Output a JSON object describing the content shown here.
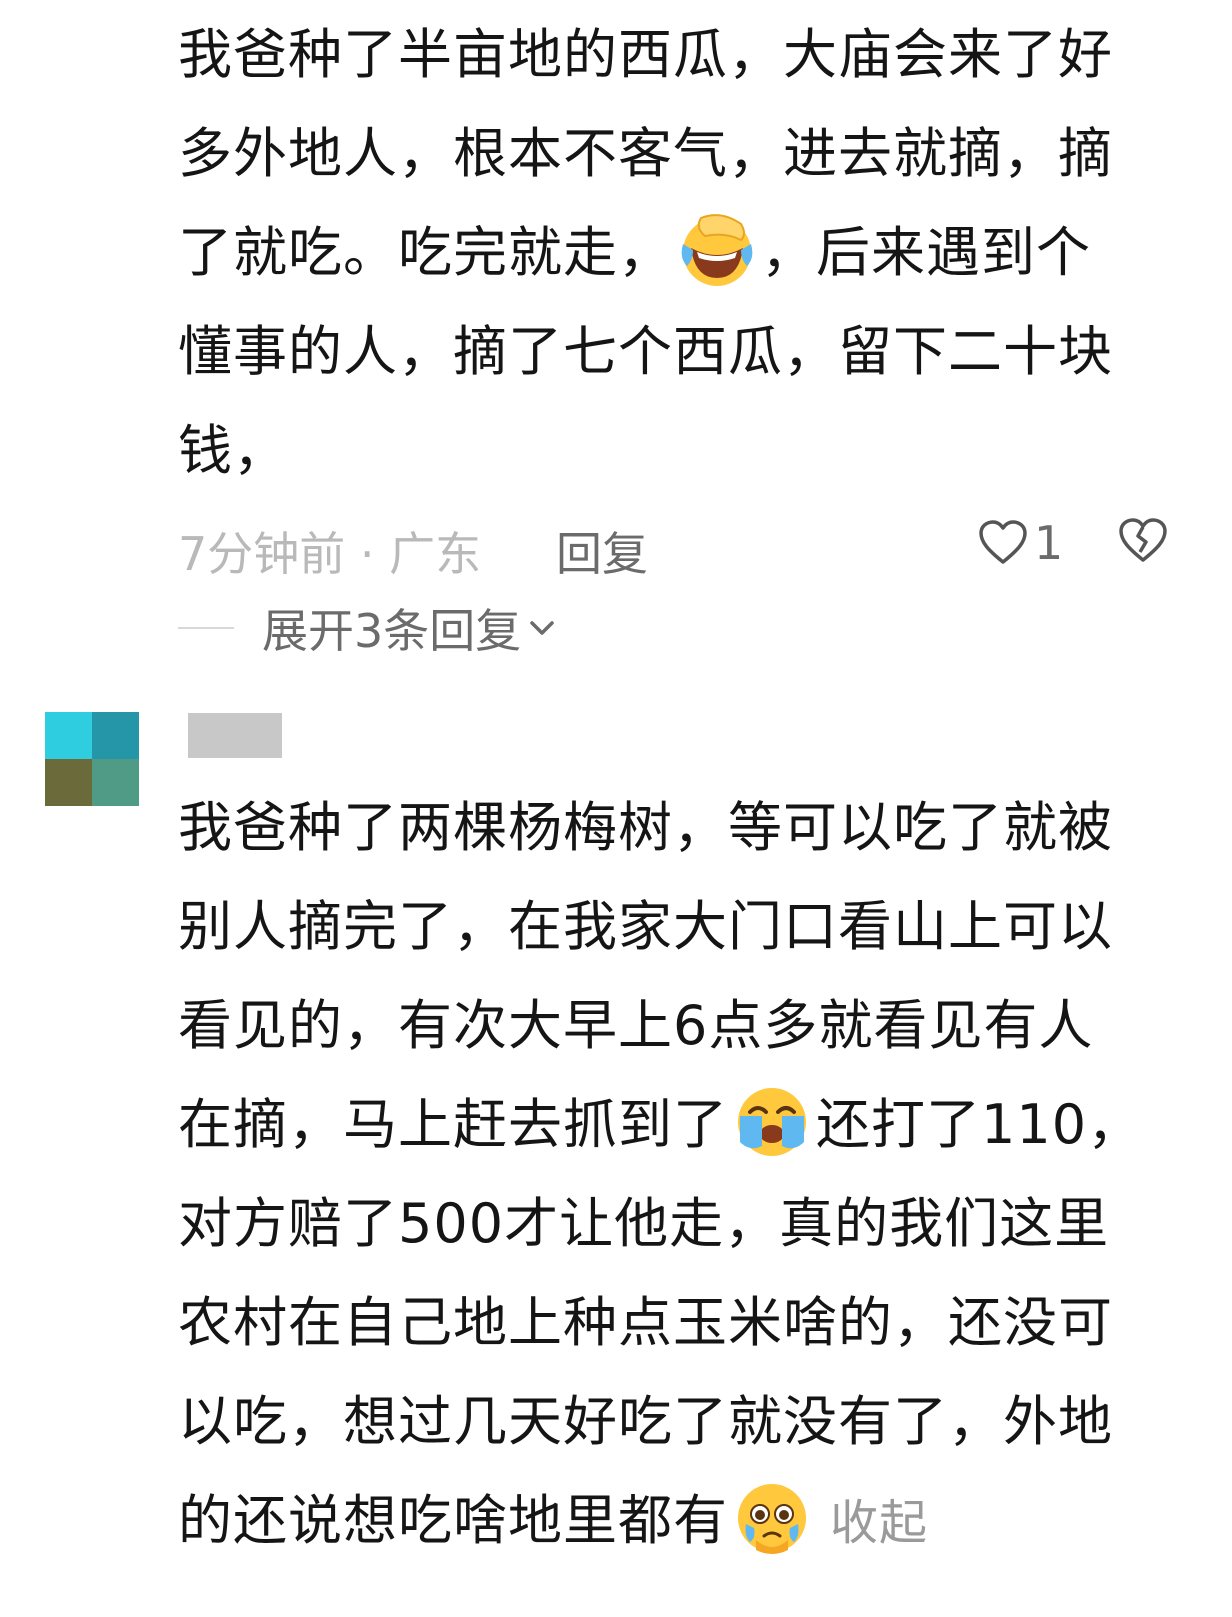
{
  "comment1": {
    "lines": [
      "我爸种了半亩地的西瓜，大庙会来了好",
      "多外地人，根本不客气，进去就摘，摘",
      "了就吃。吃完就走，",
      "，后来遇到个",
      "懂事的人，摘了七个西瓜，留下二十块",
      "钱，"
    ],
    "emoji": "facepalm-laughing-crying-emoji",
    "time_location": "7分钟前 · 广东",
    "reply_label": "回复",
    "like_count": "1",
    "expand_replies": "展开3条回复"
  },
  "comment2": {
    "avatar_colors": [
      "#2fcde0",
      "#2596a8",
      "#6b6a3a",
      "#4f9b86"
    ],
    "lines": [
      "我爸种了两棵杨梅树，等可以吃了就被",
      "别人摘完了，在我家大门口看山上可以",
      "看见的，有次大早上6点多就看见有人",
      "在摘，马上赶去抓到了",
      "还打了110，",
      "对方赔了500才让他走，真的我们这里",
      "农村在自己地上种点玉米啥的，还没可",
      "以吃，想过几天好吃了就没有了，外地",
      "的还说想吃啥地里都有"
    ],
    "emoji_crying": "loudly-crying-emoji",
    "emoji_pleading": "pleading-face-emoji",
    "collapse_label": "收起"
  }
}
